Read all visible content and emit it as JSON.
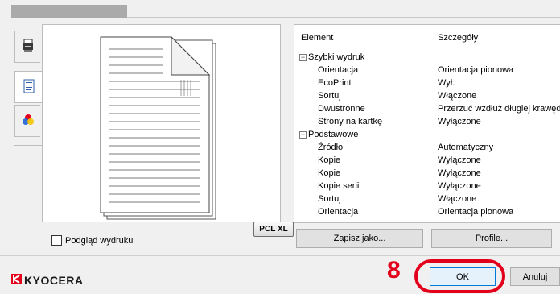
{
  "preview": {
    "badge": "PCL XL"
  },
  "tree": {
    "header": {
      "element": "Element",
      "details": "Szczegóły"
    },
    "groups": [
      {
        "title": "Szybki wydruk",
        "rows": [
          {
            "name": "Orientacja",
            "value": "Orientacja pionowa"
          },
          {
            "name": "EcoPrint",
            "value": "Wył."
          },
          {
            "name": "Sortuj",
            "value": "Włączone"
          },
          {
            "name": "Dwustronne",
            "value": "Przerzuć wzdłuż długiej krawędzi"
          },
          {
            "name": "Strony na kartkę",
            "value": "Wyłączone"
          }
        ]
      },
      {
        "title": "Podstawowe",
        "rows": [
          {
            "name": "Źródło",
            "value": "Automatyczny"
          },
          {
            "name": "Kopie",
            "value": "Wyłączone"
          },
          {
            "name": "Kopie",
            "value": "Wyłączone"
          },
          {
            "name": "Kopie serii",
            "value": "Wyłączone"
          },
          {
            "name": "Sortuj",
            "value": "Włączone"
          },
          {
            "name": "Orientacja",
            "value": "Orientacja pionowa"
          }
        ]
      }
    ]
  },
  "checkbox": {
    "label": "Podgląd wydruku"
  },
  "buttons": {
    "save_as": "Zapisz jako...",
    "profile": "Profile...",
    "ok": "OK",
    "cancel": "Anuluj"
  },
  "brand": {
    "name": "KYOCERA",
    "color": "#e3001b"
  },
  "callout": {
    "step": "8",
    "color": "#e3001b"
  },
  "sidebar": {
    "tabs": [
      {
        "icon": "printer-icon"
      },
      {
        "icon": "document-icon"
      },
      {
        "icon": "color-icon"
      }
    ]
  }
}
